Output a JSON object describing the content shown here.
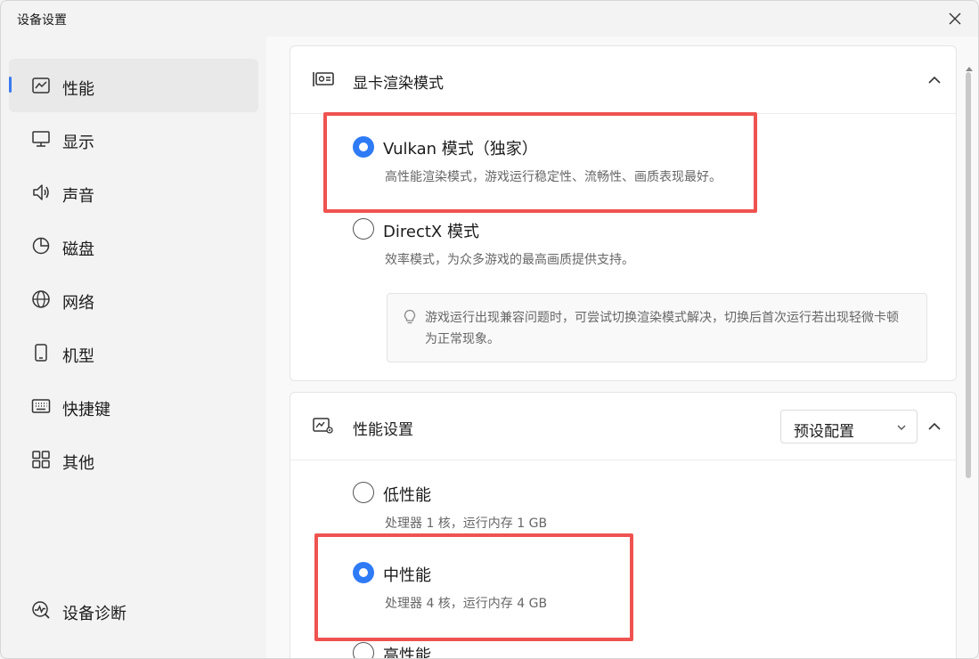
{
  "window": {
    "title": "设备设置"
  },
  "sidebar": {
    "items": [
      {
        "label": "性能",
        "icon": "performance-chart-icon",
        "active": true
      },
      {
        "label": "显示",
        "icon": "monitor-icon"
      },
      {
        "label": "声音",
        "icon": "speaker-icon"
      },
      {
        "label": "磁盘",
        "icon": "pie-chart-icon"
      },
      {
        "label": "网络",
        "icon": "globe-icon"
      },
      {
        "label": "机型",
        "icon": "phone-icon"
      },
      {
        "label": "快捷键",
        "icon": "keyboard-icon"
      },
      {
        "label": "其他",
        "icon": "grid-icon"
      }
    ],
    "diagnostics": {
      "label": "设备诊断",
      "icon": "diagnostics-icon"
    }
  },
  "render_card": {
    "title": "显卡渲染模式",
    "options": [
      {
        "label": "Vulkan 模式（独家）",
        "desc": "高性能渲染模式，游戏运行稳定性、流畅性、画质表现最好。",
        "checked": true
      },
      {
        "label": "DirectX 模式",
        "desc": "效率模式，为众多游戏的最高画质提供支持。",
        "checked": false
      }
    ],
    "tip": "游戏运行出现兼容问题时，可尝试切换渲染模式解决，切换后首次运行若出现轻微卡顿为正常现象。"
  },
  "performance_card": {
    "title": "性能设置",
    "preset": {
      "selected": "预设配置"
    },
    "options": [
      {
        "label": "低性能",
        "desc": "处理器 1 核，运行内存 1 GB",
        "checked": false
      },
      {
        "label": "中性能",
        "desc": "处理器 4 核，运行内存 4 GB",
        "checked": true
      },
      {
        "label": "高性能",
        "checked": false
      }
    ]
  },
  "colors": {
    "accent": "#2f7bf5",
    "highlight": "#ef5350"
  }
}
